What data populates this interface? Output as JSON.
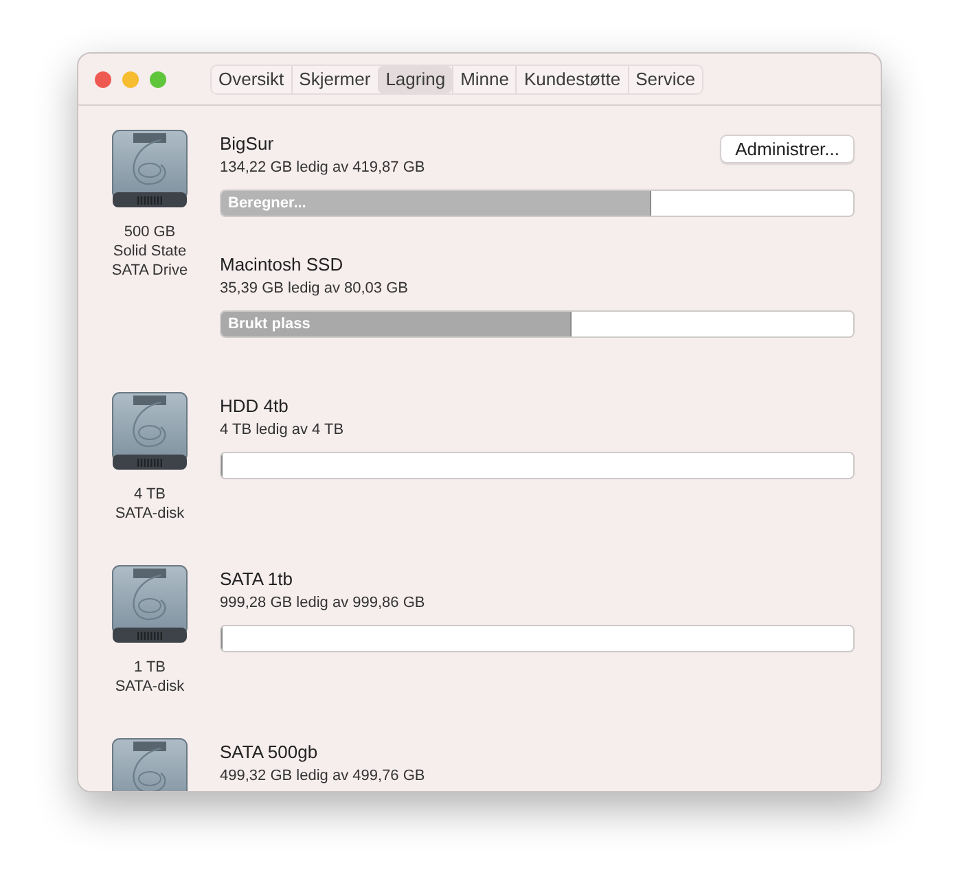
{
  "tabs": [
    {
      "label": "Oversikt",
      "selected": false
    },
    {
      "label": "Skjermer",
      "selected": false
    },
    {
      "label": "Lagring",
      "selected": true
    },
    {
      "label": "Minne",
      "selected": false
    },
    {
      "label": "Kundestøtte",
      "selected": false
    },
    {
      "label": "Service",
      "selected": false
    }
  ],
  "drives": [
    {
      "caption": [
        "500 GB",
        "Solid State",
        "SATA Drive"
      ],
      "volumes": [
        {
          "name": "BigSur",
          "info": "134,22 GB ledig av 419,87 GB",
          "button": "Administrer...",
          "bar": {
            "kind": "calculating",
            "level": 0.68,
            "label": "Beregner..."
          }
        },
        {
          "name": "Macintosh SSD",
          "info": "35,39 GB ledig av 80,03 GB",
          "bar": {
            "kind": "used",
            "level": 0.555,
            "label": "Brukt plass"
          }
        }
      ]
    },
    {
      "caption": [
        "4 TB",
        "SATA-disk"
      ],
      "volumes": [
        {
          "name": "HDD 4tb",
          "info": "4 TB ledig av 4 TB",
          "bar": {
            "kind": "used",
            "level": 0
          }
        }
      ]
    },
    {
      "caption": [
        "1 TB",
        "SATA-disk"
      ],
      "volumes": [
        {
          "name": "SATA 1tb",
          "info": "999,28 GB ledig av 999,86 GB",
          "bar": {
            "kind": "used",
            "level": 0
          }
        }
      ]
    },
    {
      "volumes": [
        {
          "name": "SATA 500gb",
          "info": "499,32 GB ledig av 499,76 GB"
        }
      ]
    }
  ]
}
